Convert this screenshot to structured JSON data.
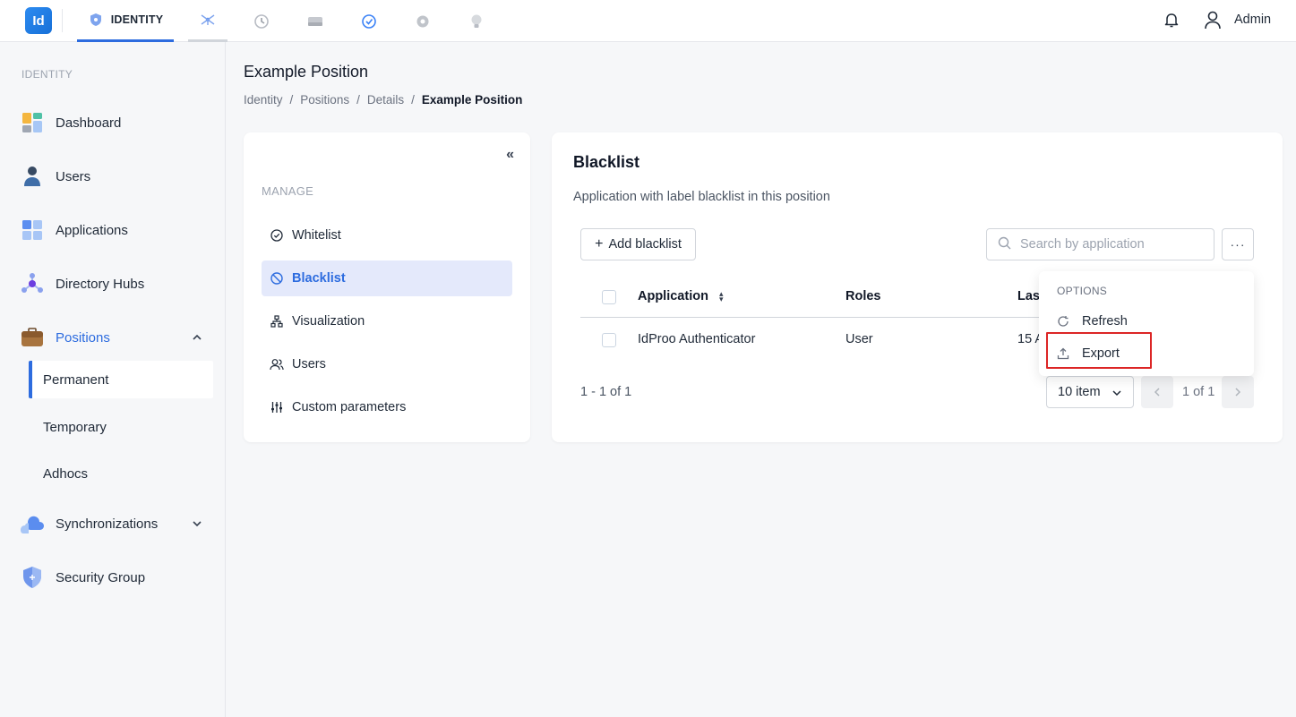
{
  "topbar": {
    "logo_text": "Id",
    "active_tab_label": "IDENTITY",
    "tabs": [
      {
        "icon": "network-icon"
      },
      {
        "icon": "history-icon"
      },
      {
        "icon": "storage-icon"
      },
      {
        "icon": "clock-check-icon"
      },
      {
        "icon": "gear-icon"
      },
      {
        "icon": "lightbulb-icon"
      }
    ],
    "user_name": "Admin"
  },
  "sidebar": {
    "section_label": "IDENTITY",
    "items": [
      {
        "label": "Dashboard",
        "icon": "dashboard-icon"
      },
      {
        "label": "Users",
        "icon": "user-icon"
      },
      {
        "label": "Applications",
        "icon": "applications-icon"
      },
      {
        "label": "Directory Hubs",
        "icon": "hub-icon"
      },
      {
        "label": "Positions",
        "icon": "briefcase-icon"
      },
      {
        "label": "Synchronizations",
        "icon": "cloud-sync-icon"
      },
      {
        "label": "Security Group",
        "icon": "shield-icon"
      }
    ],
    "position_subitems": [
      "Permanent",
      "Temporary",
      "Adhocs"
    ]
  },
  "page": {
    "title": "Example Position",
    "breadcrumb": [
      "Identity",
      "Positions",
      "Details",
      "Example Position"
    ],
    "separator": "/"
  },
  "manage": {
    "collapse_glyph": "«",
    "label": "MANAGE",
    "items": [
      {
        "label": "Whitelist",
        "icon": "check-circle-icon"
      },
      {
        "label": "Blacklist",
        "icon": "block-icon"
      },
      {
        "label": "Visualization",
        "icon": "tree-icon"
      },
      {
        "label": "Users",
        "icon": "users-icon"
      },
      {
        "label": "Custom parameters",
        "icon": "sliders-icon"
      }
    ]
  },
  "blacklist": {
    "title": "Blacklist",
    "subtitle": "Application with label blacklist in this position",
    "add_label": "Add blacklist",
    "search_placeholder": "Search by application",
    "more_label": "···",
    "columns": [
      "Application",
      "Roles",
      "Las"
    ],
    "rows": [
      {
        "application": "IdProo Authenticator",
        "roles": "User",
        "last": "15 A"
      }
    ],
    "range_text": "1 - 1 of 1",
    "page_size": "10 item",
    "page_text": "1 of 1"
  },
  "menu": {
    "header": "OPTIONS",
    "items": [
      {
        "label": "Refresh",
        "icon": "refresh-icon"
      },
      {
        "label": "Export",
        "icon": "upload-icon"
      }
    ]
  },
  "colors": {
    "accent": "#2d6cdf",
    "highlight_border": "#dc2626"
  }
}
